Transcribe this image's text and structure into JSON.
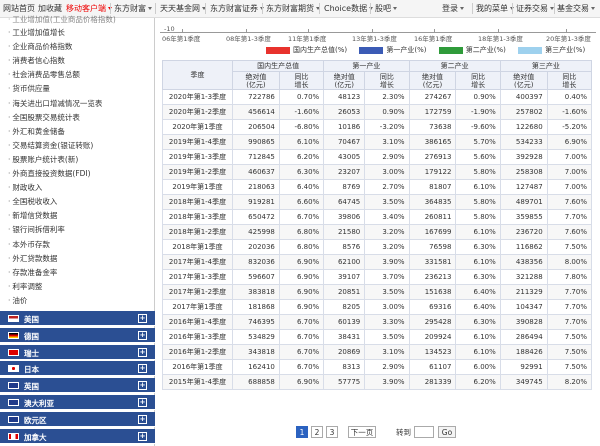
{
  "topnav": {
    "items": [
      {
        "label": "网站首页",
        "hot": false,
        "caret": false
      },
      {
        "label": "加收藏",
        "hot": false,
        "caret": false
      },
      {
        "label": "移动客户端",
        "hot": true,
        "caret": true
      },
      {
        "label": "东方财富",
        "hot": false,
        "caret": true
      },
      {
        "label": "天天基金网",
        "hot": false,
        "caret": true
      },
      {
        "label": "东方财富证券",
        "hot": false,
        "caret": true
      },
      {
        "label": "东方财富期货",
        "hot": false,
        "caret": true
      },
      {
        "label": "Choice数据",
        "hot": false,
        "caret": true
      },
      {
        "label": "股吧",
        "hot": false,
        "caret": true
      }
    ],
    "right_items": [
      {
        "label": "登录",
        "caret": true
      },
      {
        "label": "我的菜单",
        "caret": true
      },
      {
        "label": "证券交易",
        "caret": true
      },
      {
        "label": "基金交易",
        "caret": true
      }
    ]
  },
  "sidebar": {
    "cut_item": "工业增加值(工业商品价格指数)",
    "links": [
      "工业增加值增长",
      "企业商品价格指数",
      "消费者信心指数",
      "社会消费品零售总额",
      "货币供应量",
      "海关进出口增减情况一览表",
      "全国股票交易统计表",
      "外汇和黄金储备",
      "交易结算资金(银证转账)",
      "股票账户统计表(新)",
      "外商直接投资数据(FDI)",
      "财政收入",
      "全国税收收入",
      "新增信贷数据",
      "银行间拆借利率",
      "本外币存款",
      "外汇贷款数据",
      "存款准备金率",
      "利率调整",
      "油价"
    ],
    "countries": [
      {
        "label": "美国",
        "flag": "us"
      },
      {
        "label": "德国",
        "flag": "de"
      },
      {
        "label": "瑞士",
        "flag": "ch"
      },
      {
        "label": "日本",
        "flag": "jp"
      },
      {
        "label": "英国",
        "flag": "uk"
      },
      {
        "label": "澳大利亚",
        "flag": "au"
      },
      {
        "label": "欧元区",
        "flag": "eu"
      },
      {
        "label": "加拿大",
        "flag": "ca"
      }
    ],
    "plus_glyph": "+"
  },
  "chart_axis": {
    "y_tick": "-10",
    "x_ticks": [
      "06年第1季度",
      "08年第1-3季度",
      "11年第1季度",
      "13年第1-3季度",
      "16年第1季度",
      "18年第1-3季度",
      "20年第1-3季度"
    ]
  },
  "legend": [
    {
      "label": "国内生产总值(%)",
      "color": "#e8322d"
    },
    {
      "label": "第一产业(%)",
      "color": "#3b5bb5"
    },
    {
      "label": "第二产业(%)",
      "color": "#2f9b3a"
    },
    {
      "label": "第三产业(%)",
      "color": "#9ed1ee"
    }
  ],
  "table": {
    "header_quarter": "季度",
    "groups": [
      "国内生产总值",
      "第一产业",
      "第二产业",
      "第三产业"
    ],
    "sub_abs": "绝对值\n(亿元)",
    "sub_yoy": "同比\n增长",
    "rows": [
      {
        "q": "2020年第1-3季度",
        "gdp": "722786",
        "gdp_y": "0.70%",
        "p1": "48123",
        "p1_y": "2.30%",
        "p2": "274267",
        "p2_y": "0.90%",
        "p3": "400397",
        "p3_y": "0.40%"
      },
      {
        "q": "2020年第1-2季度",
        "gdp": "456614",
        "gdp_y": "-1.60%",
        "p1": "26053",
        "p1_y": "0.90%",
        "p2": "172759",
        "p2_y": "-1.90%",
        "p3": "257802",
        "p3_y": "-1.60%"
      },
      {
        "q": "2020年第1季度",
        "gdp": "206504",
        "gdp_y": "-6.80%",
        "p1": "10186",
        "p1_y": "-3.20%",
        "p2": "73638",
        "p2_y": "-9.60%",
        "p3": "122680",
        "p3_y": "-5.20%"
      },
      {
        "q": "2019年第1-4季度",
        "gdp": "990865",
        "gdp_y": "6.10%",
        "p1": "70467",
        "p1_y": "3.10%",
        "p2": "386165",
        "p2_y": "5.70%",
        "p3": "534233",
        "p3_y": "6.90%"
      },
      {
        "q": "2019年第1-3季度",
        "gdp": "712845",
        "gdp_y": "6.20%",
        "p1": "43005",
        "p1_y": "2.90%",
        "p2": "276913",
        "p2_y": "5.60%",
        "p3": "392928",
        "p3_y": "7.00%"
      },
      {
        "q": "2019年第1-2季度",
        "gdp": "460637",
        "gdp_y": "6.30%",
        "p1": "23207",
        "p1_y": "3.00%",
        "p2": "179122",
        "p2_y": "5.80%",
        "p3": "258308",
        "p3_y": "7.00%"
      },
      {
        "q": "2019年第1季度",
        "gdp": "218063",
        "gdp_y": "6.40%",
        "p1": "8769",
        "p1_y": "2.70%",
        "p2": "81807",
        "p2_y": "6.10%",
        "p3": "127487",
        "p3_y": "7.00%"
      },
      {
        "q": "2018年第1-4季度",
        "gdp": "919281",
        "gdp_y": "6.60%",
        "p1": "64745",
        "p1_y": "3.50%",
        "p2": "364835",
        "p2_y": "5.80%",
        "p3": "489701",
        "p3_y": "7.60%"
      },
      {
        "q": "2018年第1-3季度",
        "gdp": "650472",
        "gdp_y": "6.70%",
        "p1": "39806",
        "p1_y": "3.40%",
        "p2": "260811",
        "p2_y": "5.80%",
        "p3": "359855",
        "p3_y": "7.70%"
      },
      {
        "q": "2018年第1-2季度",
        "gdp": "425998",
        "gdp_y": "6.80%",
        "p1": "21580",
        "p1_y": "3.20%",
        "p2": "167699",
        "p2_y": "6.10%",
        "p3": "236720",
        "p3_y": "7.60%"
      },
      {
        "q": "2018年第1季度",
        "gdp": "202036",
        "gdp_y": "6.80%",
        "p1": "8576",
        "p1_y": "3.20%",
        "p2": "76598",
        "p2_y": "6.30%",
        "p3": "116862",
        "p3_y": "7.50%"
      },
      {
        "q": "2017年第1-4季度",
        "gdp": "832036",
        "gdp_y": "6.90%",
        "p1": "62100",
        "p1_y": "3.90%",
        "p2": "331581",
        "p2_y": "6.10%",
        "p3": "438356",
        "p3_y": "8.00%"
      },
      {
        "q": "2017年第1-3季度",
        "gdp": "596607",
        "gdp_y": "6.90%",
        "p1": "39107",
        "p1_y": "3.70%",
        "p2": "236213",
        "p2_y": "6.30%",
        "p3": "321288",
        "p3_y": "7.80%"
      },
      {
        "q": "2017年第1-2季度",
        "gdp": "383818",
        "gdp_y": "6.90%",
        "p1": "20851",
        "p1_y": "3.50%",
        "p2": "151638",
        "p2_y": "6.40%",
        "p3": "211329",
        "p3_y": "7.70%"
      },
      {
        "q": "2017年第1季度",
        "gdp": "181868",
        "gdp_y": "6.90%",
        "p1": "8205",
        "p1_y": "3.00%",
        "p2": "69316",
        "p2_y": "6.40%",
        "p3": "104347",
        "p3_y": "7.70%"
      },
      {
        "q": "2016年第1-4季度",
        "gdp": "746395",
        "gdp_y": "6.70%",
        "p1": "60139",
        "p1_y": "3.30%",
        "p2": "295428",
        "p2_y": "6.30%",
        "p3": "390828",
        "p3_y": "7.70%"
      },
      {
        "q": "2016年第1-3季度",
        "gdp": "534829",
        "gdp_y": "6.70%",
        "p1": "38431",
        "p1_y": "3.50%",
        "p2": "209924",
        "p2_y": "6.10%",
        "p3": "286494",
        "p3_y": "7.50%"
      },
      {
        "q": "2016年第1-2季度",
        "gdp": "343818",
        "gdp_y": "6.70%",
        "p1": "20869",
        "p1_y": "3.10%",
        "p2": "134523",
        "p2_y": "6.10%",
        "p3": "188426",
        "p3_y": "7.50%"
      },
      {
        "q": "2016年第1季度",
        "gdp": "162410",
        "gdp_y": "6.70%",
        "p1": "8313",
        "p1_y": "2.90%",
        "p2": "61107",
        "p2_y": "6.00%",
        "p3": "92991",
        "p3_y": "7.50%"
      },
      {
        "q": "2015年第1-4季度",
        "gdp": "688858",
        "gdp_y": "6.90%",
        "p1": "57775",
        "p1_y": "3.90%",
        "p2": "281339",
        "p2_y": "6.20%",
        "p3": "349745",
        "p3_y": "8.20%"
      }
    ]
  },
  "pager": {
    "pages": [
      "1",
      "2",
      "3"
    ],
    "current": "1",
    "next": "下一页",
    "goto": "转到",
    "go": "Go"
  },
  "colors": {
    "positive": "#e00000",
    "negative": "#008800",
    "accent": "#2b4f93"
  }
}
